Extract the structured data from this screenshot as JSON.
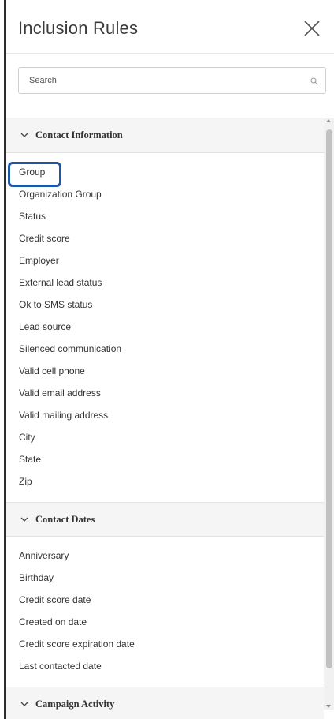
{
  "panel": {
    "title": "Inclusion Rules",
    "close_icon": "close-x-icon"
  },
  "search": {
    "placeholder": "Search",
    "value": "",
    "icon": "search-icon"
  },
  "sections": [
    {
      "title": "Contact Information",
      "expanded": true,
      "items": [
        "Group",
        "Organization Group",
        "Status",
        "Credit score",
        "Employer",
        "External lead status",
        "Ok to SMS status",
        "Lead source",
        "Silenced communication",
        "Valid cell phone",
        "Valid email address",
        "Valid mailing address",
        "City",
        "State",
        "Zip"
      ]
    },
    {
      "title": "Contact Dates",
      "expanded": true,
      "items": [
        "Anniversary",
        "Birthday",
        "Credit score date",
        "Created on date",
        "Credit score expiration date",
        "Last contacted date"
      ]
    },
    {
      "title": "Campaign Activity",
      "expanded": true,
      "items": []
    }
  ],
  "highlighted_item": "Group",
  "colors": {
    "highlight_border": "#1f56a6",
    "section_header_bg": "#f5f5f5"
  }
}
